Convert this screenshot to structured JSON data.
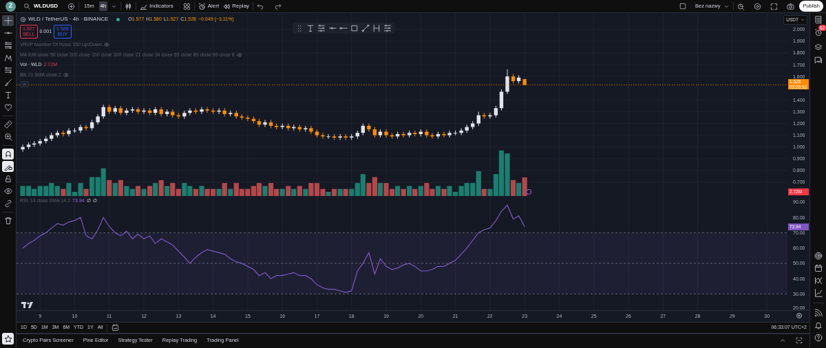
{
  "top_bar": {
    "avatar": "Z",
    "symbol": "WLDUSD",
    "intervals": [
      {
        "label": "15m",
        "selected": false
      },
      {
        "label": "4h",
        "selected": true
      }
    ],
    "tools": [
      {
        "kind": "indicators",
        "label": "Indicators"
      },
      {
        "kind": "alert",
        "label": "Alert"
      },
      {
        "kind": "replay",
        "label": "Replay"
      }
    ],
    "layout_name": "Bez nazwy",
    "publish": "Publish"
  },
  "left_toolbar": {
    "tools": [
      {
        "selected": true
      },
      {
        "selected": false
      },
      {
        "selected": false
      },
      {
        "selected": false
      },
      {
        "selected": false
      },
      {
        "selected": false
      },
      {
        "selected": false
      },
      {
        "selected": false
      },
      {
        "selected": false
      },
      {
        "selected": false
      }
    ],
    "toggles": [
      {
        "on": true
      },
      {
        "on": true
      },
      {
        "on": false
      },
      {
        "on": false
      },
      {
        "on": false
      }
    ]
  },
  "right_sidebar": {
    "alerts_badge": "62"
  },
  "legend": {
    "symbol": "WLD / TetherUS · 4h · BINANCE",
    "market_open": true,
    "ohlc": [
      {
        "label": "O",
        "value": "1.577"
      },
      {
        "label": "H",
        "value": "1.580"
      },
      {
        "label": "L",
        "value": "1.527"
      },
      {
        "label": "C",
        "value": "1.528"
      }
    ],
    "change": "−0.049 (−3.11%)",
    "sell": {
      "price": "1.527",
      "label": "SELL"
    },
    "spread": "0.001",
    "buy": {
      "price": "1.528",
      "label": "BUY"
    },
    "indicators": [
      {
        "name": "VRVP Number Of Rows 150 Up/Down",
        "hidden": true
      },
      {
        "name": "MA Krill close 50 close 200 close 100 close 300 close 21 close 34 close 55 close 89 close 99 close 8",
        "hidden": true
      },
      {
        "name": "Vol · WLD",
        "value": "2.72M",
        "hidden": false
      },
      {
        "name": "BB 21 SMA close 2",
        "hidden": true
      }
    ]
  },
  "price_pane": {
    "currency": "USDT",
    "price_tag": {
      "value": "1.528",
      "countdown": "03:26:52"
    },
    "volume_tag": "2.72M",
    "chart_data": {
      "type": "candlestick",
      "grid": true,
      "xlim": [
        8.32,
        31.23
      ],
      "ylim": [
        0.583,
        2.139
      ],
      "yticks": [
        {
          "value": 0.7,
          "label": "0.700"
        },
        {
          "value": 0.8,
          "label": "0.800"
        },
        {
          "value": 0.9,
          "label": "0.900"
        },
        {
          "value": 1.0,
          "label": "1.000"
        },
        {
          "value": 1.1,
          "label": "1.100"
        },
        {
          "value": 1.2,
          "label": "1.200"
        },
        {
          "value": 1.3,
          "label": "1.300"
        },
        {
          "value": 1.4,
          "label": "1.400"
        },
        {
          "value": 1.6,
          "label": "1.600"
        },
        {
          "value": 1.7,
          "label": "1.700"
        },
        {
          "value": 1.8,
          "label": "1.800"
        },
        {
          "value": 1.9,
          "label": "1.900"
        },
        {
          "value": 2.0,
          "label": "2.000"
        }
      ],
      "x": [
        8.5,
        8.67,
        8.83,
        9,
        9.17,
        9.33,
        9.5,
        9.67,
        9.83,
        10,
        10.17,
        10.33,
        10.5,
        10.67,
        10.83,
        11,
        11.17,
        11.33,
        11.5,
        11.67,
        11.83,
        12,
        12.17,
        12.33,
        12.5,
        12.67,
        12.83,
        13,
        13.17,
        13.33,
        13.5,
        13.67,
        13.83,
        14,
        14.17,
        14.33,
        14.5,
        14.67,
        14.83,
        15,
        15.17,
        15.33,
        15.5,
        15.67,
        15.83,
        16,
        16.17,
        16.33,
        16.5,
        16.67,
        16.83,
        17,
        17.17,
        17.33,
        17.5,
        17.67,
        17.83,
        18,
        18.17,
        18.33,
        18.5,
        18.67,
        18.83,
        19,
        19.17,
        19.33,
        19.5,
        19.67,
        19.83,
        20,
        20.17,
        20.33,
        20.5,
        20.67,
        20.83,
        21,
        21.17,
        21.33,
        21.5,
        21.67,
        21.83,
        22,
        22.17,
        22.33,
        22.5,
        22.67,
        22.83,
        23
      ],
      "ohlc": [
        [
          0.98,
          1.02,
          0.96,
          1.0
        ],
        [
          1.0,
          1.04,
          0.98,
          1.02
        ],
        [
          1.02,
          1.05,
          1.0,
          1.03
        ],
        [
          1.03,
          1.07,
          1.01,
          1.05
        ],
        [
          1.05,
          1.09,
          1.03,
          1.07
        ],
        [
          1.07,
          1.12,
          1.05,
          1.1
        ],
        [
          1.1,
          1.14,
          1.08,
          1.12
        ],
        [
          1.12,
          1.14,
          1.09,
          1.11
        ],
        [
          1.11,
          1.16,
          1.09,
          1.14
        ],
        [
          1.14,
          1.16,
          1.12,
          1.14
        ],
        [
          1.14,
          1.19,
          1.12,
          1.17
        ],
        [
          1.17,
          1.19,
          1.14,
          1.16
        ],
        [
          1.16,
          1.23,
          1.14,
          1.21
        ],
        [
          1.21,
          1.28,
          1.19,
          1.26
        ],
        [
          1.26,
          1.36,
          1.24,
          1.34
        ],
        [
          1.34,
          1.36,
          1.28,
          1.3
        ],
        [
          1.3,
          1.35,
          1.28,
          1.33
        ],
        [
          1.33,
          1.35,
          1.27,
          1.29
        ],
        [
          1.29,
          1.33,
          1.27,
          1.31
        ],
        [
          1.31,
          1.34,
          1.29,
          1.32
        ],
        [
          1.32,
          1.34,
          1.28,
          1.3
        ],
        [
          1.3,
          1.33,
          1.28,
          1.31
        ],
        [
          1.31,
          1.33,
          1.27,
          1.29
        ],
        [
          1.29,
          1.34,
          1.27,
          1.32
        ],
        [
          1.32,
          1.34,
          1.26,
          1.28
        ],
        [
          1.28,
          1.32,
          1.26,
          1.3
        ],
        [
          1.3,
          1.32,
          1.25,
          1.27
        ],
        [
          1.27,
          1.29,
          1.24,
          1.26
        ],
        [
          1.26,
          1.31,
          1.24,
          1.29
        ],
        [
          1.29,
          1.33,
          1.27,
          1.31
        ],
        [
          1.31,
          1.33,
          1.28,
          1.3
        ],
        [
          1.3,
          1.34,
          1.28,
          1.32
        ],
        [
          1.32,
          1.34,
          1.29,
          1.31
        ],
        [
          1.31,
          1.33,
          1.28,
          1.3
        ],
        [
          1.3,
          1.33,
          1.28,
          1.31
        ],
        [
          1.31,
          1.33,
          1.26,
          1.28
        ],
        [
          1.28,
          1.31,
          1.26,
          1.29
        ],
        [
          1.29,
          1.31,
          1.24,
          1.26
        ],
        [
          1.26,
          1.28,
          1.23,
          1.25
        ],
        [
          1.25,
          1.27,
          1.22,
          1.24
        ],
        [
          1.24,
          1.26,
          1.2,
          1.22
        ],
        [
          1.22,
          1.24,
          1.17,
          1.19
        ],
        [
          1.19,
          1.23,
          1.17,
          1.21
        ],
        [
          1.21,
          1.23,
          1.16,
          1.18
        ],
        [
          1.18,
          1.2,
          1.15,
          1.17
        ],
        [
          1.17,
          1.2,
          1.15,
          1.18
        ],
        [
          1.18,
          1.2,
          1.14,
          1.16
        ],
        [
          1.16,
          1.19,
          1.14,
          1.17
        ],
        [
          1.17,
          1.19,
          1.13,
          1.15
        ],
        [
          1.15,
          1.18,
          1.13,
          1.16
        ],
        [
          1.16,
          1.18,
          1.11,
          1.13
        ],
        [
          1.13,
          1.15,
          1.08,
          1.1
        ],
        [
          1.1,
          1.12,
          1.07,
          1.09
        ],
        [
          1.09,
          1.11,
          1.07,
          1.09
        ],
        [
          1.09,
          1.11,
          1.06,
          1.08
        ],
        [
          1.08,
          1.11,
          1.06,
          1.09
        ],
        [
          1.09,
          1.11,
          1.06,
          1.08
        ],
        [
          1.08,
          1.11,
          1.06,
          1.09
        ],
        [
          1.09,
          1.14,
          1.07,
          1.12
        ],
        [
          1.12,
          1.2,
          1.1,
          1.18
        ],
        [
          1.18,
          1.2,
          1.13,
          1.15
        ],
        [
          1.15,
          1.17,
          1.08,
          1.1
        ],
        [
          1.1,
          1.15,
          1.08,
          1.13
        ],
        [
          1.13,
          1.15,
          1.08,
          1.1
        ],
        [
          1.1,
          1.12,
          1.07,
          1.09
        ],
        [
          1.09,
          1.13,
          1.07,
          1.11
        ],
        [
          1.11,
          1.13,
          1.08,
          1.1
        ],
        [
          1.1,
          1.14,
          1.08,
          1.12
        ],
        [
          1.12,
          1.14,
          1.09,
          1.11
        ],
        [
          1.11,
          1.15,
          1.09,
          1.13
        ],
        [
          1.13,
          1.15,
          1.08,
          1.1
        ],
        [
          1.1,
          1.12,
          1.07,
          1.09
        ],
        [
          1.09,
          1.13,
          1.07,
          1.11
        ],
        [
          1.11,
          1.13,
          1.08,
          1.1
        ],
        [
          1.1,
          1.14,
          1.08,
          1.12
        ],
        [
          1.12,
          1.14,
          1.1,
          1.12
        ],
        [
          1.12,
          1.16,
          1.1,
          1.14
        ],
        [
          1.14,
          1.19,
          1.12,
          1.17
        ],
        [
          1.17,
          1.22,
          1.15,
          1.2
        ],
        [
          1.2,
          1.3,
          1.18,
          1.27
        ],
        [
          1.27,
          1.29,
          1.24,
          1.26
        ],
        [
          1.26,
          1.29,
          1.24,
          1.27
        ],
        [
          1.27,
          1.35,
          1.25,
          1.33
        ],
        [
          1.33,
          1.49,
          1.31,
          1.47
        ],
        [
          1.47,
          1.66,
          1.45,
          1.6
        ],
        [
          1.6,
          1.62,
          1.54,
          1.56
        ],
        [
          1.56,
          1.61,
          1.54,
          1.59
        ],
        [
          1.577,
          1.58,
          1.527,
          1.528
        ]
      ]
    }
  },
  "rsi_pane": {
    "legend": "14 close SMA 14 2",
    "value": "73.94",
    "extras": [
      "∅",
      "∅"
    ],
    "value_tag": "73.94",
    "chart_data": {
      "type": "line",
      "grid": true,
      "xlim": [
        8.32,
        31.23
      ],
      "ylim": [
        -5.94,
        94
      ],
      "yticks": [
        {
          "value": 20,
          "label": "20.00"
        },
        {
          "value": 30,
          "label": "30.00"
        },
        {
          "value": 40,
          "label": "40.00"
        },
        {
          "value": 50,
          "label": "50.00"
        },
        {
          "value": 60,
          "label": "60.00"
        },
        {
          "value": 70,
          "label": "70.00"
        },
        {
          "value": 80,
          "label": "80.00"
        },
        {
          "value": 90,
          "label": "90.00"
        }
      ],
      "xticks": [
        9,
        10,
        11,
        12,
        13,
        14,
        15,
        16,
        17,
        18,
        19,
        20,
        21,
        22,
        23,
        24,
        25,
        26,
        27,
        28,
        29,
        30
      ],
      "x": [
        8.5,
        8.67,
        8.83,
        9,
        9.17,
        9.33,
        9.5,
        9.67,
        9.83,
        10,
        10.17,
        10.33,
        10.5,
        10.67,
        10.83,
        11,
        11.17,
        11.33,
        11.5,
        11.67,
        11.83,
        12,
        12.17,
        12.33,
        12.5,
        12.67,
        12.83,
        13,
        13.17,
        13.33,
        13.5,
        13.67,
        13.83,
        14,
        14.17,
        14.33,
        14.5,
        14.67,
        14.83,
        15,
        15.17,
        15.33,
        15.5,
        15.67,
        15.83,
        16,
        16.17,
        16.33,
        16.5,
        16.67,
        16.83,
        17,
        17.17,
        17.33,
        17.5,
        17.67,
        17.83,
        18,
        18.17,
        18.33,
        18.5,
        18.67,
        18.83,
        19,
        19.17,
        19.33,
        19.5,
        19.67,
        19.83,
        20,
        20.17,
        20.33,
        20.5,
        20.67,
        20.83,
        21,
        21.17,
        21.33,
        21.5,
        21.67,
        21.83,
        22,
        22.17,
        22.33,
        22.5,
        22.67,
        22.83,
        23
      ],
      "series": [
        {
          "name": "RSI",
          "color": "#7e57c2",
          "values": [
            60,
            63,
            65,
            68,
            70,
            73,
            76,
            75,
            77,
            78,
            80,
            68,
            66,
            72,
            80,
            74,
            70,
            68,
            71,
            66,
            69,
            66,
            68,
            63,
            66,
            64,
            62,
            58,
            54,
            50,
            54,
            57,
            59,
            58,
            57,
            56,
            53,
            51,
            50,
            48,
            46,
            42,
            44,
            40,
            42,
            42,
            43,
            44,
            42,
            42,
            40,
            36,
            34,
            33,
            33,
            32,
            31,
            32,
            45,
            50,
            57,
            43,
            53,
            48,
            46,
            47,
            49,
            50,
            48,
            45,
            45,
            46,
            48,
            48,
            50,
            52,
            56,
            60,
            65,
            70,
            72,
            73,
            78,
            84,
            88,
            79,
            81,
            74
          ]
        }
      ]
    }
  },
  "range_bar": {
    "ranges": [
      "1D",
      "5D",
      "1M",
      "3M",
      "6M",
      "YTD",
      "1Y",
      "All"
    ],
    "clock": "06:33:07 UTC+2"
  },
  "bottom_tabs": [
    "Crypto Pairs Screener",
    "Pine Editor",
    "Strategy Tester",
    "Replay Trading",
    "Trading Panel"
  ]
}
